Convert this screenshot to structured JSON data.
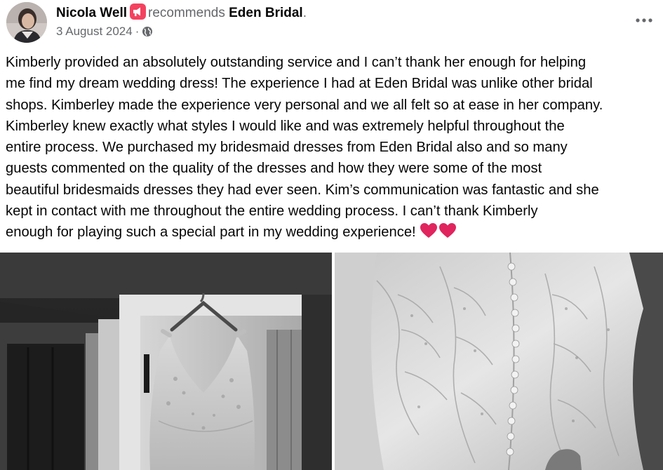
{
  "post": {
    "author": "Nicola Well",
    "action": "recommends",
    "page": "Eden Bridal",
    "punctuation": ".",
    "date": "3 August 2024",
    "separator": "·",
    "audience_icon": "globe-icon",
    "recommend_icon": "megaphone-icon",
    "more_icon": "ellipsis-icon",
    "text": "Kimberly provided an absolutely outstanding service and I can’t thank her enough for helping\nme find my dream wedding dress! The experience I had at Eden Bridal was unlike other bridal\nshops. Kimberley made the experience very personal and we all felt so at ease in her company.\nKimberley knew exactly what styles I would like and was extremely helpful throughout the\nentire process. We purchased my bridesmaid dresses from Eden Bridal also and so many\nguests commented on the quality of the dresses and how they were some of the most\nbeautiful bridesmaids dresses they had ever seen. Kim’s communication was fantastic and she\nkept in contact with me throughout the entire wedding process. I can’t thank Kimberly\nenough for playing such a special part in my wedding experience! ",
    "emoji": "red-heart-icon ×2",
    "colors": {
      "name_text": "#050505",
      "secondary_text": "#65676b",
      "recommend_badge": "#f3425f",
      "heart": "#e0245e"
    }
  },
  "photos": [
    {
      "name": "photo-dress-on-hanger",
      "tone": "black-and-white"
    },
    {
      "name": "photo-dress-lace-detail",
      "tone": "black-and-white"
    }
  ]
}
